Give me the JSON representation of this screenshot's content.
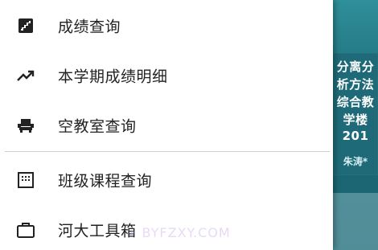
{
  "drawer": {
    "items": [
      {
        "label": "成绩查询",
        "icon": "stairs-grade-icon"
      },
      {
        "label": "本学期成绩明细",
        "icon": "trending-up-icon"
      },
      {
        "label": "空教室查询",
        "icon": "seat-icon"
      },
      {
        "label": "班级课程查询",
        "icon": "grid-timetable-icon"
      },
      {
        "label": "河大工具箱",
        "icon": "briefcase-icon"
      }
    ]
  },
  "background_app": {
    "course_lines": [
      "分离分",
      "析方法",
      "综合教",
      "学楼",
      "201"
    ],
    "teacher": "朱涛*"
  },
  "watermark": {
    "text": "• BYFZXY.COM"
  },
  "colors": {
    "drawer_bg": "#ffffff",
    "icon": "#222222",
    "text": "#222222",
    "divider": "#cfcfcf",
    "bg_teal": "#1f6a78"
  }
}
